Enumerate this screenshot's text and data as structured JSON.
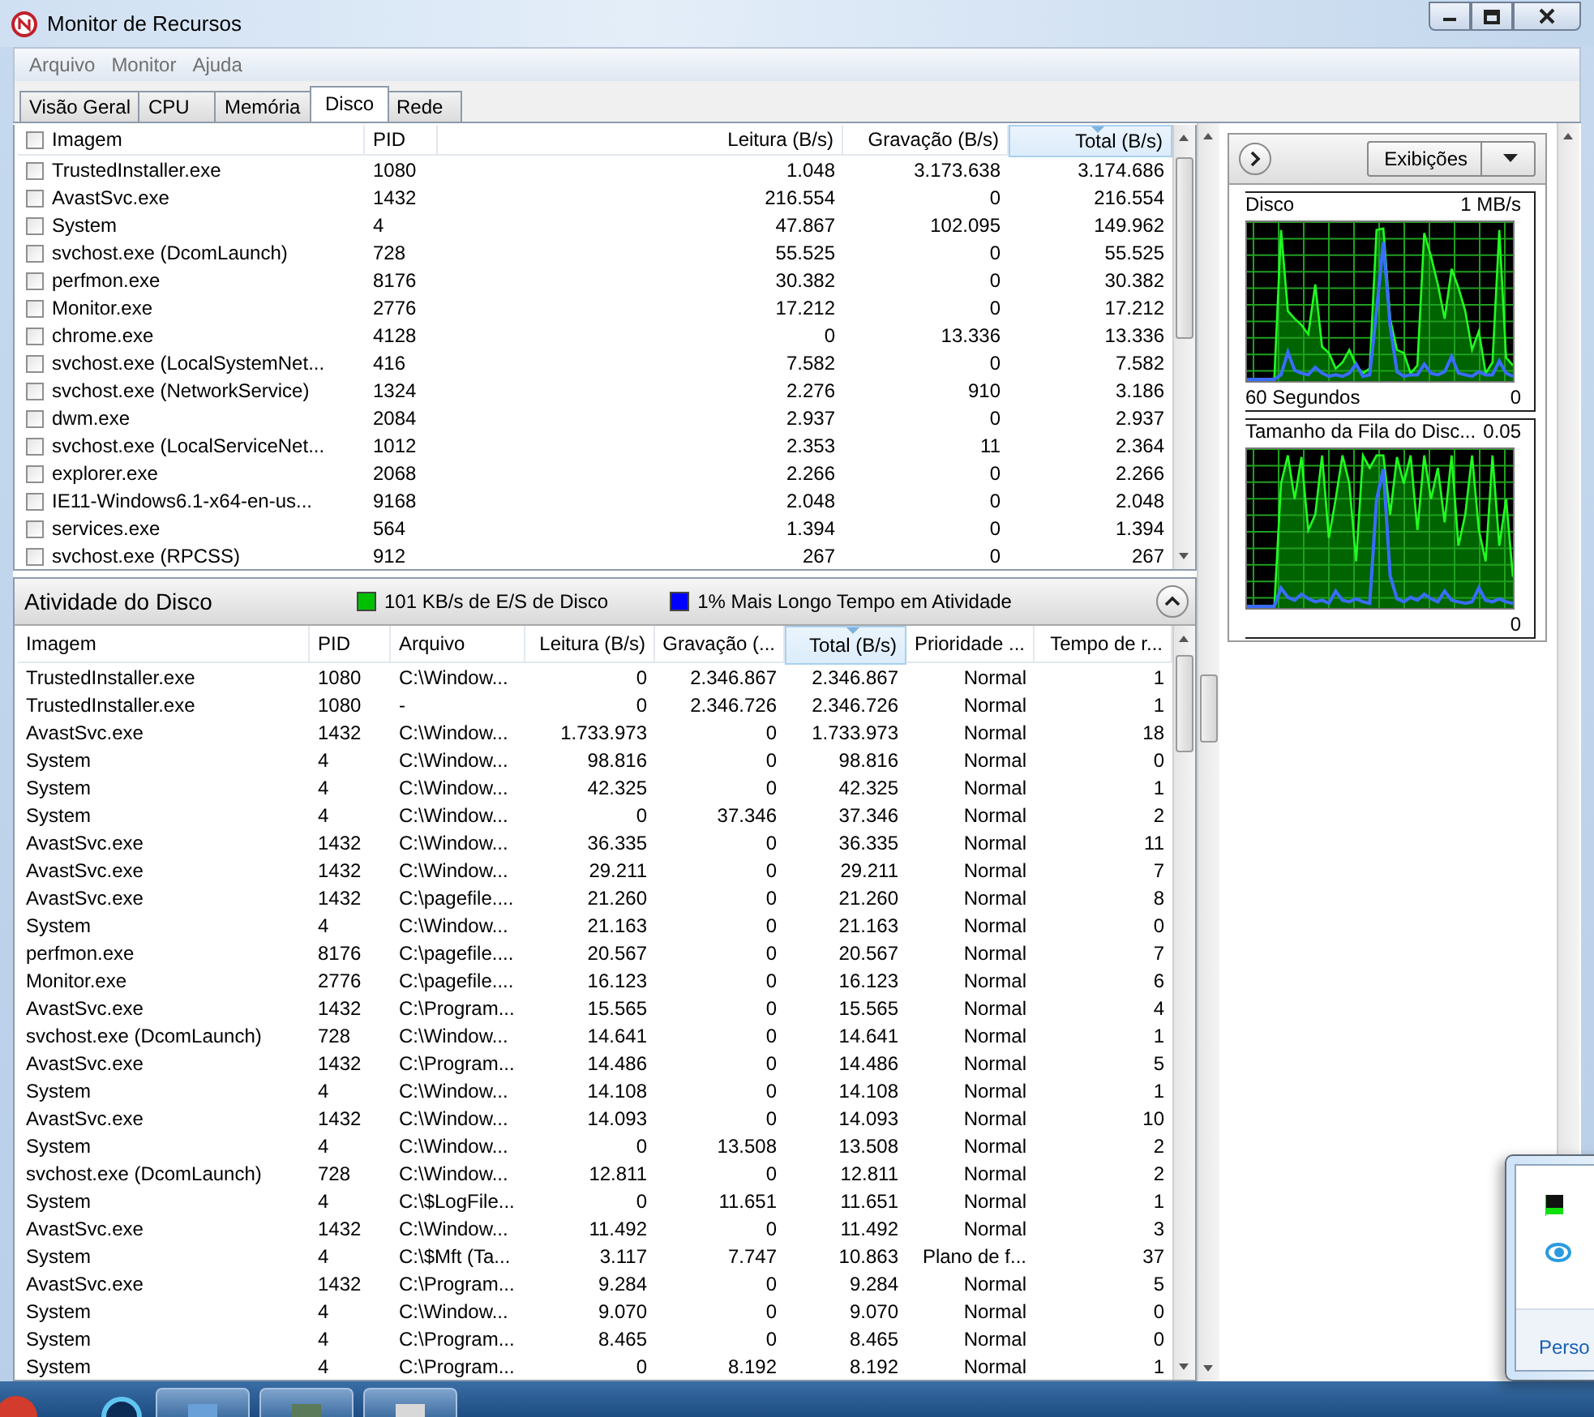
{
  "window": {
    "title": "Monitor de Recursos"
  },
  "menu": [
    "Arquivo",
    "Monitor",
    "Ajuda"
  ],
  "tabs": [
    {
      "label": "Visão Geral",
      "selected": false
    },
    {
      "label": "CPU",
      "selected": false
    },
    {
      "label": "Memória",
      "selected": false
    },
    {
      "label": "Disco",
      "selected": true
    },
    {
      "label": "Rede",
      "selected": false
    }
  ],
  "processes": {
    "all_checked": false,
    "columns": [
      {
        "label": "Imagem",
        "kind": "text",
        "sorted": false
      },
      {
        "label": "PID",
        "kind": "text",
        "sorted": false
      },
      {
        "label": "Leitura (B/s)",
        "kind": "number",
        "sorted": false
      },
      {
        "label": "Gravação (B/s)",
        "kind": "number",
        "sorted": false
      },
      {
        "label": "Total (B/s)",
        "kind": "number",
        "sorted": true
      }
    ],
    "rows": [
      {
        "checked": false,
        "cells": [
          "TrustedInstaller.exe",
          "1080",
          "1.048",
          "3.173.638",
          "3.174.686"
        ]
      },
      {
        "checked": false,
        "cells": [
          "AvastSvc.exe",
          "1432",
          "216.554",
          "0",
          "216.554"
        ]
      },
      {
        "checked": false,
        "cells": [
          "System",
          "4",
          "47.867",
          "102.095",
          "149.962"
        ]
      },
      {
        "checked": false,
        "cells": [
          "svchost.exe (DcomLaunch)",
          "728",
          "55.525",
          "0",
          "55.525"
        ]
      },
      {
        "checked": false,
        "cells": [
          "perfmon.exe",
          "8176",
          "30.382",
          "0",
          "30.382"
        ]
      },
      {
        "checked": false,
        "cells": [
          "Monitor.exe",
          "2776",
          "17.212",
          "0",
          "17.212"
        ]
      },
      {
        "checked": false,
        "cells": [
          "chrome.exe",
          "4128",
          "0",
          "13.336",
          "13.336"
        ]
      },
      {
        "checked": false,
        "cells": [
          "svchost.exe (LocalSystemNet...",
          "416",
          "7.582",
          "0",
          "7.582"
        ]
      },
      {
        "checked": false,
        "cells": [
          "svchost.exe (NetworkService)",
          "1324",
          "2.276",
          "910",
          "3.186"
        ]
      },
      {
        "checked": false,
        "cells": [
          "dwm.exe",
          "2084",
          "2.937",
          "0",
          "2.937"
        ]
      },
      {
        "checked": false,
        "cells": [
          "svchost.exe (LocalServiceNet...",
          "1012",
          "2.353",
          "11",
          "2.364"
        ]
      },
      {
        "checked": false,
        "cells": [
          "explorer.exe",
          "2068",
          "2.266",
          "0",
          "2.266"
        ]
      },
      {
        "checked": false,
        "cells": [
          "IE11-Windows6.1-x64-en-us...",
          "9168",
          "2.048",
          "0",
          "2.048"
        ]
      },
      {
        "checked": false,
        "cells": [
          "services.exe",
          "564",
          "1.394",
          "0",
          "1.394"
        ]
      },
      {
        "checked": false,
        "cells": [
          "svchost.exe (RPCSS)",
          "912",
          "267",
          "0",
          "267"
        ]
      }
    ]
  },
  "disk_activity": {
    "title": "Atividade do Disco",
    "expanded": true,
    "legend": [
      {
        "label": "101 KB/s de E/S de Disco",
        "color": "#00c000"
      },
      {
        "label": "1% Mais Longo Tempo em Atividade",
        "color": "#0000ff"
      }
    ],
    "columns": [
      {
        "label": "Imagem",
        "kind": "text",
        "sorted": false
      },
      {
        "label": "PID",
        "kind": "text",
        "sorted": false
      },
      {
        "label": "Arquivo",
        "kind": "text",
        "sorted": false
      },
      {
        "label": "Leitura (B/s)",
        "kind": "number",
        "sorted": false
      },
      {
        "label": "Gravação (...",
        "kind": "number",
        "sorted": false
      },
      {
        "label": "Total (B/s)",
        "kind": "number",
        "sorted": true
      },
      {
        "label": "Prioridade ...",
        "kind": "number",
        "sorted": false
      },
      {
        "label": "Tempo de r...",
        "kind": "number",
        "sorted": false
      }
    ],
    "rows": [
      {
        "cells": [
          "TrustedInstaller.exe",
          "1080",
          "C:\\Window...",
          "0",
          "2.346.867",
          "2.346.867",
          "Normal",
          "1"
        ]
      },
      {
        "cells": [
          "TrustedInstaller.exe",
          "1080",
          "-",
          "0",
          "2.346.726",
          "2.346.726",
          "Normal",
          "1"
        ]
      },
      {
        "cells": [
          "AvastSvc.exe",
          "1432",
          "C:\\Window...",
          "1.733.973",
          "0",
          "1.733.973",
          "Normal",
          "18"
        ]
      },
      {
        "cells": [
          "System",
          "4",
          "C:\\Window...",
          "98.816",
          "0",
          "98.816",
          "Normal",
          "0"
        ]
      },
      {
        "cells": [
          "System",
          "4",
          "C:\\Window...",
          "42.325",
          "0",
          "42.325",
          "Normal",
          "1"
        ]
      },
      {
        "cells": [
          "System",
          "4",
          "C:\\Window...",
          "0",
          "37.346",
          "37.346",
          "Normal",
          "2"
        ]
      },
      {
        "cells": [
          "AvastSvc.exe",
          "1432",
          "C:\\Window...",
          "36.335",
          "0",
          "36.335",
          "Normal",
          "11"
        ]
      },
      {
        "cells": [
          "AvastSvc.exe",
          "1432",
          "C:\\Window...",
          "29.211",
          "0",
          "29.211",
          "Normal",
          "7"
        ]
      },
      {
        "cells": [
          "AvastSvc.exe",
          "1432",
          "C:\\pagefile....",
          "21.260",
          "0",
          "21.260",
          "Normal",
          "8"
        ]
      },
      {
        "cells": [
          "System",
          "4",
          "C:\\Window...",
          "21.163",
          "0",
          "21.163",
          "Normal",
          "0"
        ]
      },
      {
        "cells": [
          "perfmon.exe",
          "8176",
          "C:\\pagefile....",
          "20.567",
          "0",
          "20.567",
          "Normal",
          "7"
        ]
      },
      {
        "cells": [
          "Monitor.exe",
          "2776",
          "C:\\pagefile....",
          "16.123",
          "0",
          "16.123",
          "Normal",
          "6"
        ]
      },
      {
        "cells": [
          "AvastSvc.exe",
          "1432",
          "C:\\Program...",
          "15.565",
          "0",
          "15.565",
          "Normal",
          "4"
        ]
      },
      {
        "cells": [
          "svchost.exe (DcomLaunch)",
          "728",
          "C:\\Window...",
          "14.641",
          "0",
          "14.641",
          "Normal",
          "1"
        ]
      },
      {
        "cells": [
          "AvastSvc.exe",
          "1432",
          "C:\\Program...",
          "14.486",
          "0",
          "14.486",
          "Normal",
          "5"
        ]
      },
      {
        "cells": [
          "System",
          "4",
          "C:\\Window...",
          "14.108",
          "0",
          "14.108",
          "Normal",
          "1"
        ]
      },
      {
        "cells": [
          "AvastSvc.exe",
          "1432",
          "C:\\Window...",
          "14.093",
          "0",
          "14.093",
          "Normal",
          "10"
        ]
      },
      {
        "cells": [
          "System",
          "4",
          "C:\\Window...",
          "0",
          "13.508",
          "13.508",
          "Normal",
          "2"
        ]
      },
      {
        "cells": [
          "svchost.exe (DcomLaunch)",
          "728",
          "C:\\Window...",
          "12.811",
          "0",
          "12.811",
          "Normal",
          "2"
        ]
      },
      {
        "cells": [
          "System",
          "4",
          "C:\\$LogFile...",
          "0",
          "11.651",
          "11.651",
          "Normal",
          "1"
        ]
      },
      {
        "cells": [
          "AvastSvc.exe",
          "1432",
          "C:\\Window...",
          "11.492",
          "0",
          "11.492",
          "Normal",
          "3"
        ]
      },
      {
        "cells": [
          "System",
          "4",
          "C:\\$Mft (Ta...",
          "3.117",
          "7.747",
          "10.863",
          "Plano de f...",
          "37"
        ]
      },
      {
        "cells": [
          "AvastSvc.exe",
          "1432",
          "C:\\Program...",
          "9.284",
          "0",
          "9.284",
          "Normal",
          "5"
        ]
      },
      {
        "cells": [
          "System",
          "4",
          "C:\\Window...",
          "9.070",
          "0",
          "9.070",
          "Normal",
          "0"
        ]
      },
      {
        "cells": [
          "System",
          "4",
          "C:\\Program...",
          "8.465",
          "0",
          "8.465",
          "Normal",
          "0"
        ]
      },
      {
        "cells": [
          "System",
          "4",
          "C:\\Program...",
          "0",
          "8.192",
          "8.192",
          "Normal",
          "1"
        ]
      }
    ]
  },
  "side_panel": {
    "views_button": "Exibições",
    "graphs": [
      {
        "title": "Disco",
        "scale_max": "1 MB/s",
        "time_span": "60 Segundos",
        "scale_min": "0"
      },
      {
        "title": "Tamanho da Fila do Disc...",
        "scale_max": "0.05",
        "scale_min": "0"
      }
    ]
  },
  "tray_popup": {
    "link": "Perso"
  }
}
